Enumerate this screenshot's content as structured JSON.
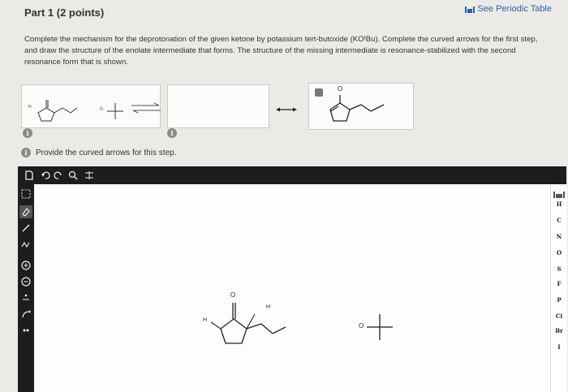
{
  "header": {
    "part_title": "Part 1  (2 points)",
    "periodic_link": "See Periodic Table"
  },
  "instructions": {
    "text": "Complete the mechanism for the deprotonation of the given ketone by potassium tert-butoxide (KOᵗBu). Complete the curved arrows for the first step, and draw the structure of the enolate intermediate that forms. The structure of the missing intermediate is resonance-stabilized with the second resonance form that is shown."
  },
  "mechanism": {
    "box1_info": "i",
    "box2_info": "i",
    "enolate_oxygen_label": "O",
    "box1_h_label": "H",
    "box1_base_label": "O"
  },
  "step": {
    "info": "i",
    "label": "Provide the curved arrows for this step."
  },
  "editor": {
    "canvas_h1": "H",
    "canvas_h2": "H",
    "canvas_o": "O",
    "canvas_base_o": "O",
    "elements": [
      "H",
      "C",
      "N",
      "O",
      "S",
      "F",
      "P",
      "Cl",
      "Br",
      "I"
    ]
  },
  "colors": {
    "accent_link": "#2b5fb3",
    "toolbar_bg": "#1d1d1d",
    "page_bg": "#eceae6"
  }
}
